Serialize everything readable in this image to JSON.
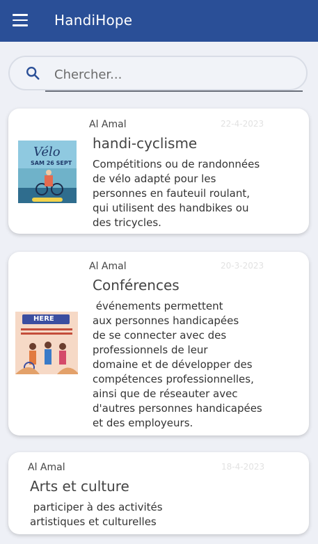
{
  "app": {
    "title": "HandiHope"
  },
  "search": {
    "placeholder": "Chercher..."
  },
  "cards": [
    {
      "author": "Al Amal",
      "date": "22-4-2023",
      "title": "handi-cyclisme",
      "description": "Compétitions ou de randonnées\nde vélo adapté pour les\npersonnes en fauteuil roulant,\nqui utilisent des handbikes ou\ndes tricycles.",
      "thumb_text": "Vélo",
      "thumb_sub": "SAM 26 SEPT"
    },
    {
      "author": "Al Amal",
      "date": "20-3-2023",
      "title": "Conférences",
      "description": " événements permettent\naux personnes handicapées\nde se connecter avec des\nprofessionnels de leur\ndomaine et de développer des\ncompétences professionnelles,\nainsi que de réseauter avec\nd'autres personnes handicapées\net des employeurs.",
      "thumb_text": "HERE"
    },
    {
      "author": "Al Amal",
      "date": "18-4-2023",
      "title": "Arts et culture",
      "description": " participer à des activités\nartistiques et culturelles"
    }
  ]
}
